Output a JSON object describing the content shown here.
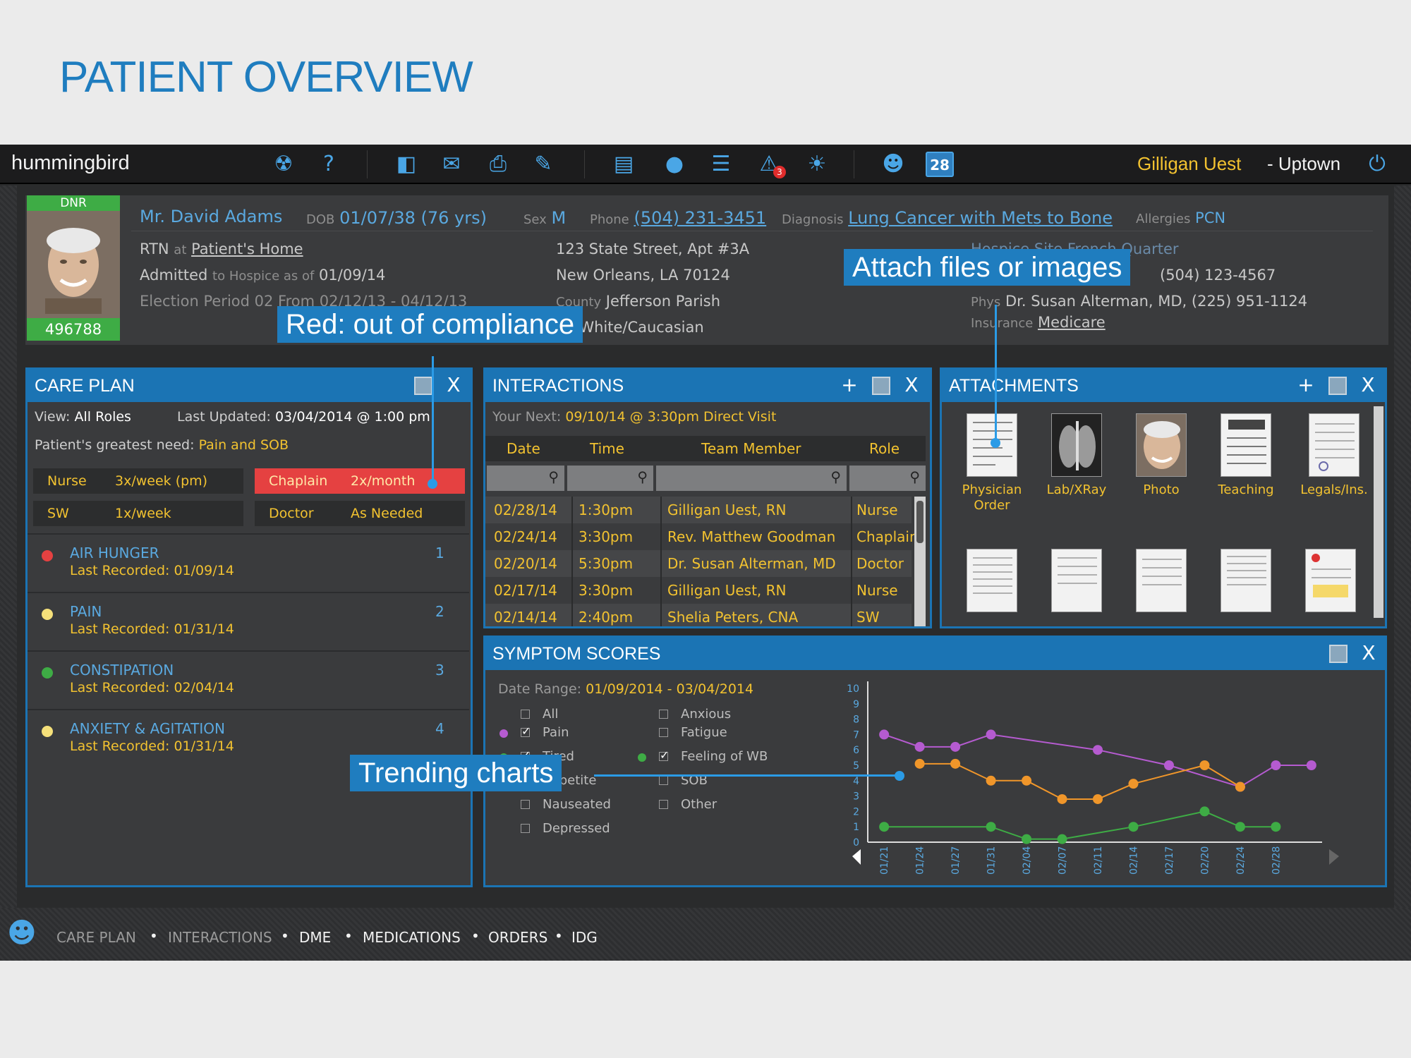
{
  "slide_title": "PATIENT OVERVIEW",
  "app": {
    "brand": "hummingbird",
    "user_name": "Gilligan Uest",
    "user_location": "- Uptown",
    "alert_count": "3",
    "calendar_day": "28"
  },
  "patient": {
    "dnr": "DNR",
    "mrn": "496788",
    "name": "Mr. David Adams",
    "dob_label": "DOB",
    "dob": "01/07/38 (76 yrs)",
    "sex_label": "Sex",
    "sex": "M",
    "phone_label": "Phone",
    "phone": "(504) 231-3451",
    "diagnosis_label": "Diagnosis",
    "diagnosis": "Lung Cancer with Mets to Bone",
    "allergies_label": "Allergies",
    "allergies": "PCN",
    "rtn_label": "RTN",
    "rtn_at": "at",
    "rtn_location": "Patient's Home",
    "admitted": "Admitted",
    "admitted_to": "to Hospice as of",
    "admitted_date": "01/09/14",
    "election": "Election Period 02 From 02/12/13 - 04/12/13",
    "address1": "123 State Street, Apt #3A",
    "address2": "New Orleans, LA 70124",
    "county_label": "County",
    "county": "Jefferson Parish",
    "race": "ed/White/Caucasian",
    "hospice_site": "Hospice Site French Quarter",
    "site_phone": "(504) 123-4567",
    "phys_label": "Phys",
    "phys": "Dr. Susan Alterman, MD, (225) 951-1124",
    "insurance_label": "Insurance",
    "insurance": "Medicare"
  },
  "care_plan": {
    "title": "CARE PLAN",
    "view_label": "View:",
    "view": "All Roles",
    "updated_label": "Last Updated:",
    "updated": "03/04/2014 @ 1:00 pm",
    "need_label": "Patient's greatest need:",
    "need": "Pain and SOB",
    "frequencies": [
      {
        "role": "Nurse",
        "freq": "3x/week (pm)"
      },
      {
        "role": "Chaplain",
        "freq": "2x/month"
      },
      {
        "role": "SW",
        "freq": "1x/week"
      },
      {
        "role": "Doctor",
        "freq": "As Needed"
      }
    ],
    "needs": [
      {
        "name": "AIR HUNGER",
        "rank": "1",
        "recorded": "Last Recorded: 01/09/14",
        "color": "#e54141"
      },
      {
        "name": "PAIN",
        "rank": "2",
        "recorded": "Last Recorded: 01/31/14",
        "color": "#f5e07a"
      },
      {
        "name": "CONSTIPATION",
        "rank": "3",
        "recorded": "Last Recorded: 02/04/14",
        "color": "#3eac45"
      },
      {
        "name": "ANXIETY & AGITATION",
        "rank": "4",
        "recorded": "Last Recorded: 01/31/14",
        "color": "#f5e07a"
      }
    ]
  },
  "interactions": {
    "title": "INTERACTIONS",
    "next_label": "Your Next:",
    "next": "09/10/14 @ 3:30pm Direct Visit",
    "columns": [
      "Date",
      "Time",
      "Team Member",
      "Role"
    ],
    "rows": [
      {
        "date": "02/28/14",
        "time": "1:30pm",
        "member": "Gilligan Uest, RN",
        "role": "Nurse"
      },
      {
        "date": "02/24/14",
        "time": "3:30pm",
        "member": "Rev. Matthew Goodman",
        "role": "Chaplain"
      },
      {
        "date": "02/20/14",
        "time": "5:30pm",
        "member": "Dr. Susan Alterman, MD",
        "role": "Doctor"
      },
      {
        "date": "02/17/14",
        "time": "3:30pm",
        "member": "Gilligan Uest, RN",
        "role": "Nurse"
      },
      {
        "date": "02/14/14",
        "time": "2:40pm",
        "member": "Shelia Peters, CNA",
        "role": "SW"
      }
    ]
  },
  "attachments": {
    "title": "ATTACHMENTS",
    "items": [
      "Physician Order",
      "Lab/XRay",
      "Photo",
      "Teaching",
      "Legals/Ins."
    ]
  },
  "symptom_scores": {
    "title": "SYMPTOM SCORES",
    "range_label": "Date Range:",
    "range": "01/09/2014 - 03/04/2014",
    "options_left": [
      "All",
      "Pain",
      "Tired",
      "Appetite",
      "Nauseated",
      "Depressed"
    ],
    "options_right": [
      "Anxious",
      "Fatigue",
      "Feeling of WB",
      "SOB",
      "Other"
    ]
  },
  "chart_data": {
    "type": "line",
    "x": [
      "01/21",
      "01/24",
      "01/27",
      "01/31",
      "02/04",
      "02/07",
      "02/11",
      "02/14",
      "02/17",
      "02/20",
      "02/24",
      "02/28"
    ],
    "ylim": [
      0,
      10
    ],
    "yticks": [
      "0",
      "1",
      "2",
      "3",
      "4",
      "5",
      "6",
      "7",
      "8",
      "9",
      "10"
    ],
    "series": [
      {
        "name": "Pain",
        "color": "#b55bd0",
        "points": [
          [
            0,
            7
          ],
          [
            1,
            6.2
          ],
          [
            2,
            6.2
          ],
          [
            3,
            7
          ],
          [
            6,
            6
          ],
          [
            8,
            5
          ],
          [
            10,
            3.6
          ],
          [
            11,
            5
          ],
          [
            12,
            5
          ]
        ]
      },
      {
        "name": "Tired",
        "color": "#f0962a",
        "points": [
          [
            1,
            5.1
          ],
          [
            2,
            5.1
          ],
          [
            3,
            4
          ],
          [
            4,
            4
          ],
          [
            5,
            2.8
          ],
          [
            6,
            2.8
          ],
          [
            7,
            3.8
          ],
          [
            9,
            5
          ],
          [
            10,
            3.6
          ]
        ]
      },
      {
        "name": "Feeling of WB",
        "color": "#3eac45",
        "points": [
          [
            0,
            1
          ],
          [
            3,
            1
          ],
          [
            4,
            0.2
          ],
          [
            5,
            0.2
          ],
          [
            7,
            1
          ],
          [
            9,
            2
          ],
          [
            10,
            1
          ],
          [
            11,
            1
          ]
        ]
      }
    ]
  },
  "bottom_nav": [
    "CARE PLAN",
    "INTERACTIONS",
    "DME",
    "MEDICATIONS",
    "ORDERS",
    "IDG"
  ],
  "callouts": {
    "compliance": "Red: out of compliance",
    "attach": "Attach files or images",
    "trending": "Trending charts"
  }
}
